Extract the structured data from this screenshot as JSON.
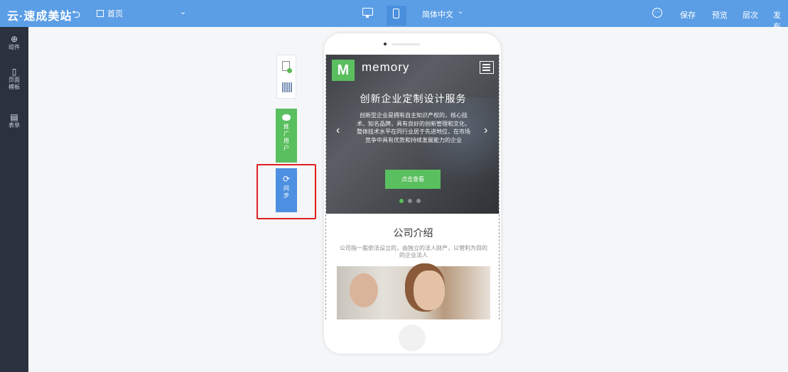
{
  "topbar": {
    "logo": "云·速成美站",
    "page_selector": "首页",
    "language": "简体中文",
    "actions": [
      "保存",
      "预览",
      "层次",
      "发布"
    ],
    "color": "#5b9ee6"
  },
  "sidebar": {
    "items": [
      {
        "icon": "plus-circle-icon",
        "label": "组件"
      },
      {
        "icon": "page-template-icon",
        "label": "页面模板"
      },
      {
        "icon": "form-icon",
        "label": "表单"
      }
    ]
  },
  "floating_tools": {
    "green_button_label": "推广用户",
    "blue_button_label": "同步"
  },
  "phone_preview": {
    "brand_initial": "M",
    "brand_name": "memory",
    "hero_title": "创新企业定制设计服务",
    "hero_desc": "创新型企业是拥有自主知识产权的，核心技术、知名品牌，具有良好的创新管理和文化，整体技术水平在同行业居于先进地位，在市场竞争中具有优势和持续发展能力的企业",
    "cta_label": "点击查看",
    "intro_title": "公司介绍",
    "intro_desc": "公司指一般依法设立的，由独立的法人财产，以营利为目的的企业法人",
    "accent": "#5abf5e"
  }
}
